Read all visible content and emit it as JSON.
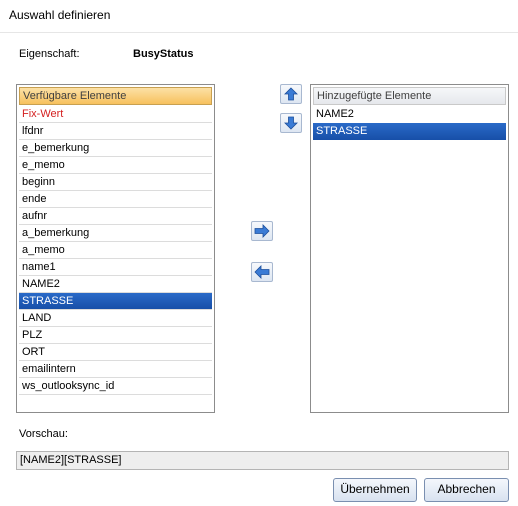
{
  "window": {
    "title": "Auswahl definieren"
  },
  "property": {
    "label": "Eigenschaft:",
    "value": "BusyStatus"
  },
  "available": {
    "header": "Verfügbare Elemente",
    "items": [
      {
        "label": "Fix-Wert",
        "style": "red"
      },
      {
        "label": "lfdnr"
      },
      {
        "label": "e_bemerkung"
      },
      {
        "label": "e_memo"
      },
      {
        "label": "beginn"
      },
      {
        "label": "ende"
      },
      {
        "label": "aufnr"
      },
      {
        "label": "a_bemerkung"
      },
      {
        "label": "a_memo"
      },
      {
        "label": "name1"
      },
      {
        "label": "NAME2"
      },
      {
        "label": "STRASSE",
        "selected": true
      },
      {
        "label": "LAND"
      },
      {
        "label": "PLZ"
      },
      {
        "label": "ORT"
      },
      {
        "label": "emailintern"
      },
      {
        "label": "ws_outlooksync_id"
      }
    ]
  },
  "added": {
    "header": "Hinzugefügte Elemente",
    "items": [
      {
        "label": "NAME2"
      },
      {
        "label": "STRASSE",
        "selected": true
      }
    ]
  },
  "controls": {
    "move_up_icon": "arrow-up-icon",
    "move_down_icon": "arrow-down-icon",
    "add_icon": "arrow-right-icon",
    "remove_icon": "arrow-left-icon"
  },
  "preview": {
    "label": "Vorschau:",
    "value": "[NAME2][STRASSE]"
  },
  "buttons": {
    "ok": "Übernehmen",
    "cancel": "Abbrechen"
  },
  "colors": {
    "selection": "#1f5fbf",
    "fix_value": "#d42020",
    "header_accent": "#f7c15e"
  }
}
